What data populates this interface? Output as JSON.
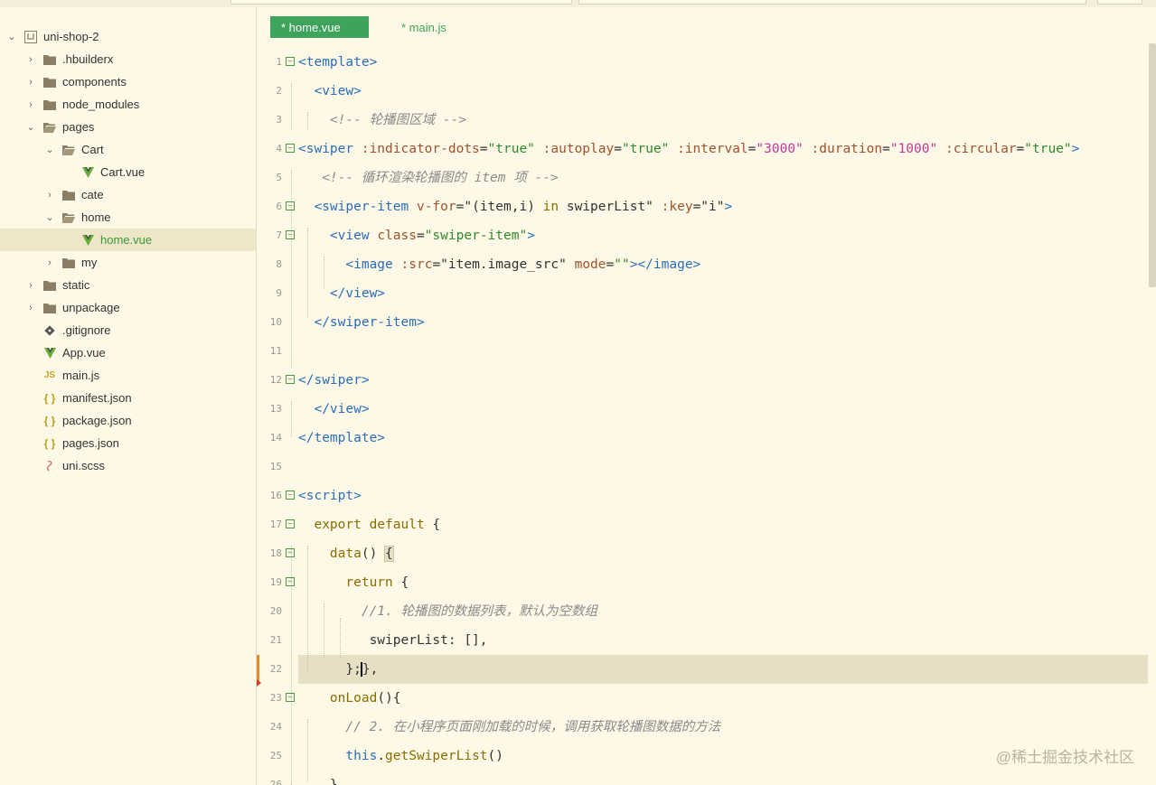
{
  "sidebar": {
    "items": [
      {
        "label": "uni-shop-2",
        "icon": "project-icon",
        "level": 0,
        "expanded": true
      },
      {
        "label": ".hbuilderx",
        "icon": "folder-icon",
        "level": 1,
        "expanded": false
      },
      {
        "label": "components",
        "icon": "folder-icon",
        "level": 1,
        "expanded": false
      },
      {
        "label": "node_modules",
        "icon": "folder-icon",
        "level": 1,
        "expanded": false
      },
      {
        "label": "pages",
        "icon": "folder-open-icon",
        "level": 1,
        "expanded": true
      },
      {
        "label": "Cart",
        "icon": "folder-open-icon",
        "level": 2,
        "expanded": true
      },
      {
        "label": "Cart.vue",
        "icon": "vue-file-icon",
        "level": 3
      },
      {
        "label": "cate",
        "icon": "folder-icon",
        "level": 2,
        "expanded": false
      },
      {
        "label": "home",
        "icon": "folder-open-icon",
        "level": 2,
        "expanded": true
      },
      {
        "label": "home.vue",
        "icon": "vue-file-icon",
        "level": 3,
        "selected": true
      },
      {
        "label": "my",
        "icon": "folder-icon",
        "level": 2,
        "expanded": false
      },
      {
        "label": "static",
        "icon": "folder-icon",
        "level": 1,
        "expanded": false
      },
      {
        "label": "unpackage",
        "icon": "folder-icon",
        "level": 1,
        "expanded": false
      },
      {
        "label": ".gitignore",
        "icon": "git-icon",
        "level": 1
      },
      {
        "label": "App.vue",
        "icon": "vue-file-icon",
        "level": 1
      },
      {
        "label": "main.js",
        "icon": "js-file-icon",
        "level": 1
      },
      {
        "label": "manifest.json",
        "icon": "json-file-icon",
        "level": 1
      },
      {
        "label": "package.json",
        "icon": "json-file-icon",
        "level": 1
      },
      {
        "label": "pages.json",
        "icon": "json-file-icon",
        "level": 1
      },
      {
        "label": "uni.scss",
        "icon": "scss-file-icon",
        "level": 1
      }
    ]
  },
  "tabs": [
    {
      "label": "* home.vue",
      "active": true
    },
    {
      "label": "* main.js",
      "active": false
    }
  ],
  "code": {
    "line_numbers": [
      "1",
      "2",
      "3",
      "4",
      "5",
      "6",
      "7",
      "8",
      "9",
      "10",
      "11",
      "12",
      "13",
      "14",
      "15",
      "16",
      "17",
      "18",
      "19",
      "20",
      "21",
      "22",
      "23",
      "24",
      "25",
      "26"
    ],
    "current_line": 22
  },
  "watermark": "@稀土掘金技术社区",
  "colors": {
    "accent": "#3fa45b",
    "background": "#fdf9e6",
    "selection": "#ede6c9"
  }
}
